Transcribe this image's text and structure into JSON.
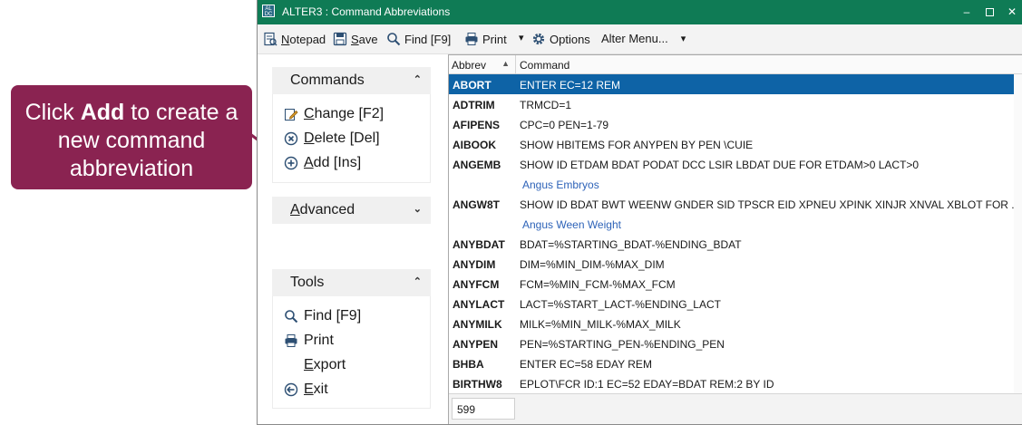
{
  "callout": {
    "pre": "Click ",
    "bold": "Add",
    "post": " to create a new command abbreviation"
  },
  "window": {
    "icon_text": "AL DC",
    "title": "ALTER3 : Command Abbreviations",
    "minimize": "–",
    "close": "✕"
  },
  "toolbar": {
    "notepad": {
      "accel": "N",
      "rest": "otepad",
      "icon": "notepad-icon"
    },
    "save": {
      "accel": "S",
      "rest": "ave",
      "icon": "save-icon"
    },
    "find": {
      "label": "Find [F9]",
      "icon": "search-icon"
    },
    "print": {
      "label": "Print",
      "icon": "printer-icon"
    },
    "print_dropdown": "▾",
    "options": {
      "label": "Options",
      "icon": "gear-icon"
    },
    "alter_menu": {
      "label": "Alter Menu...",
      "arrow": "▾"
    }
  },
  "panels": {
    "commands": {
      "title": "Commands",
      "chevron": "⌃",
      "items": [
        {
          "accel": "C",
          "rest": "hange [F2]",
          "icon": "edit-icon"
        },
        {
          "accel": "D",
          "rest": "elete [Del]",
          "icon": "delete-icon"
        },
        {
          "accel": "A",
          "rest": "dd [Ins]",
          "icon": "add-icon"
        }
      ]
    },
    "advanced": {
      "accel": "A",
      "rest": "dvanced",
      "chevron": "⌄"
    },
    "tools": {
      "title": "Tools",
      "chevron": "⌃",
      "items": [
        {
          "pre": "Find [F9]",
          "icon": "search-icon"
        },
        {
          "pre": "Print",
          "icon": "printer-icon"
        },
        {
          "accel": "E",
          "rest": "xport",
          "icon": ""
        },
        {
          "accel": "E",
          "rest": "xit",
          "icon": "exit-icon"
        }
      ]
    }
  },
  "grid": {
    "headers": {
      "abbrev": "Abbrev",
      "command": "Command"
    },
    "sort_icon": "▲",
    "rows": [
      {
        "abbrev": "ABORT",
        "command": "ENTER EC=12 REM",
        "selected": true
      },
      {
        "abbrev": "ADTRIM",
        "command": "TRMCD=1"
      },
      {
        "abbrev": "AFIPENS",
        "command": "CPC=0 PEN=1-79"
      },
      {
        "abbrev": "AIBOOK",
        "command": "SHOW HBITEMS FOR ANYPEN BY PEN \\CUIE"
      },
      {
        "abbrev": "ANGEMB",
        "command": "SHOW ID ETDAM BDAT PODAT DCC LSIR LBDAT DUE FOR ETDAM>0 LACT>0",
        "description": "Angus Embryos"
      },
      {
        "abbrev": "ANGW8T",
        "command": "SHOW ID BDAT BWT WEENW GNDER SID TPSCR EID XPNEU XPINK XINJR XNVAL XBLOT FOR ...",
        "description": "Angus Ween Weight"
      },
      {
        "abbrev": "ANYBDAT",
        "command": "BDAT=%STARTING_BDAT-%ENDING_BDAT"
      },
      {
        "abbrev": "ANYDIM",
        "command": "DIM=%MIN_DIM-%MAX_DIM"
      },
      {
        "abbrev": "ANYFCM",
        "command": "FCM=%MIN_FCM-%MAX_FCM"
      },
      {
        "abbrev": "ANYLACT",
        "command": "LACT=%START_LACT-%ENDING_LACT"
      },
      {
        "abbrev": "ANYMILK",
        "command": "MILK=%MIN_MILK-%MAX_MILK"
      },
      {
        "abbrev": "ANYPEN",
        "command": "PEN=%STARTING_PEN-%ENDING_PEN"
      },
      {
        "abbrev": "BHBA",
        "command": "ENTER EC=58 EDAY REM"
      },
      {
        "abbrev": "BIRTHW8",
        "command": "EPLOT\\FCR ID:1 EC=52 EDAY=BDAT REM:2 BY ID"
      }
    ],
    "count": "599"
  },
  "colors": {
    "titlebar": "#0f7b55",
    "selection": "#0e63a6",
    "callout": "#8a2351",
    "description": "#2e63b8"
  }
}
